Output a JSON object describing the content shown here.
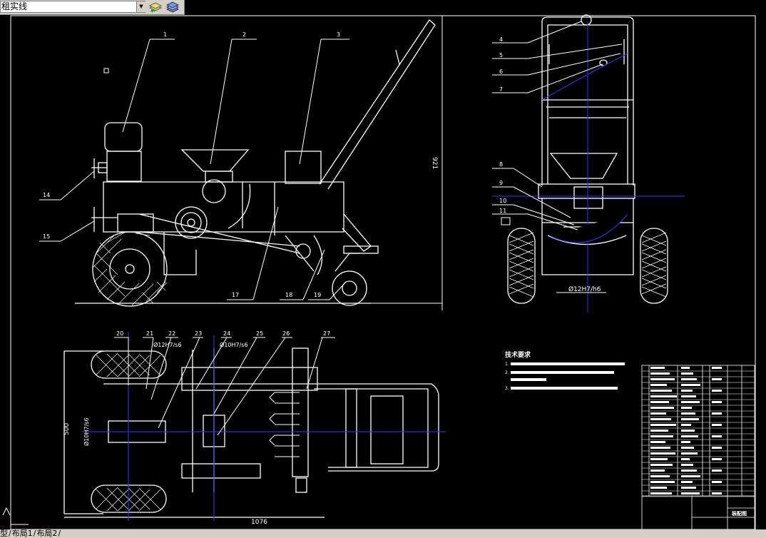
{
  "toolbar": {
    "layer_value": "粗实线",
    "layer_value_visible": "租实线",
    "layer_states_icon": "layer-stack-icon",
    "layer_previous_icon": "layer-previous-icon"
  },
  "drawing": {
    "part_numbers_front": [
      "1",
      "2",
      "3",
      "14",
      "15",
      "17",
      "18",
      "19"
    ],
    "part_numbers_side": [
      "4",
      "5",
      "6",
      "7",
      "8",
      "9",
      "10",
      "11"
    ],
    "part_numbers_top": [
      "20",
      "21",
      "22",
      "23",
      "24",
      "25",
      "26",
      "27"
    ],
    "dimension_height": "921",
    "fit_side": "Ø12H7/h6",
    "fit_top_1": "Ø12H7/s6",
    "fit_top_2": "Ø10H7/s6",
    "fit_top_left": "Ø10H7/s6",
    "dimension_width_top": "500",
    "dimension_length_top": "1076",
    "tech_title": "技术要求",
    "tech_items": [
      "1.",
      "2.",
      "3."
    ],
    "title_block_name": "装配图"
  },
  "tabs": {
    "model": "型",
    "layout1": "布局1",
    "layout2": "布局2"
  },
  "colors": {
    "background": "#000000",
    "lines": "#ffffff",
    "centerline": "#3333ff",
    "toolbar": "#d4d0c8"
  }
}
